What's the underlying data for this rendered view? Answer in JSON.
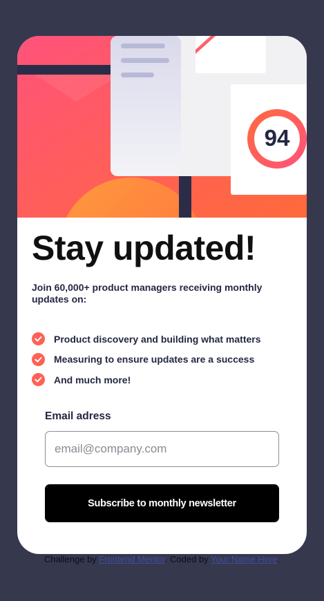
{
  "hero": {
    "score": "94",
    "image_name": "dashboard-illustration"
  },
  "content": {
    "title": "Stay updated!",
    "intro": "Join 60,000+ product managers receiving monthly updates on:",
    "features": [
      "Product discovery and building what matters",
      "Measuring to ensure updates are a success",
      "And much more!"
    ]
  },
  "form": {
    "email_label": "Email adress",
    "email_placeholder": "email@company.com",
    "email_value": "",
    "submit_label": "Subscribe to monthly newsletter"
  },
  "footer": {
    "prefix": "Challenge by ",
    "link1": "Frontend Mentor",
    "middle": ". Coded by ",
    "link2": "Your Name Here",
    "suffix": "."
  },
  "colors": {
    "background": "#36384e",
    "card": "#ffffff",
    "accent_tomato": "#ff6155",
    "dark_navy": "#242742",
    "button": "#000000"
  }
}
